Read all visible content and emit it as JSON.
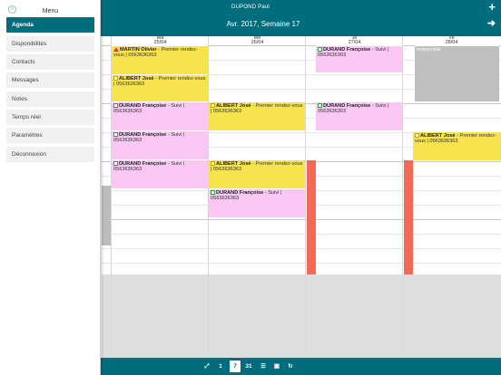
{
  "topbar": {
    "user_name": "DUPOND Paul",
    "week_title": "Avr. 2017, Semaine 17",
    "add_label": "+",
    "next_label": "➜"
  },
  "days": [
    {
      "name": "Ma",
      "date": "25/04"
    },
    {
      "name": "Me",
      "date": "26/04"
    },
    {
      "name": "Je",
      "date": "27/04"
    },
    {
      "name": "Ve",
      "date": "28/04"
    }
  ],
  "events": [
    {
      "who": "MARTIN Olivier",
      "detail": " - Premier rendez-vous | 0563636363",
      "color": "yellow",
      "icon": "warn"
    },
    {
      "who": "ALIBERT José",
      "detail": " - Premier rendez-vous | 0563636363",
      "color": "yellow",
      "icon": "note"
    },
    {
      "who": "DURAND Françoise",
      "detail": " - Suivi | 0563636363",
      "color": "pink",
      "icon": "ok"
    },
    {
      "who": "DURAND Françoise",
      "detail": " - Suivi | 0563636363",
      "color": "pink",
      "icon": "ok"
    },
    {
      "who": "DURAND Françoise",
      "detail": " - Suivi | 0563636363",
      "color": "pink",
      "icon": "ok"
    },
    {
      "who": "ALIBERT José",
      "detail": " - Premier rendez-vous | 0563636363",
      "color": "yellow",
      "icon": "note"
    },
    {
      "who": "ALIBERT José",
      "detail": " - Premier rendez-vous | 0563636363",
      "color": "yellow",
      "icon": "note"
    },
    {
      "who": "DURAND Françoise",
      "detail": " - Suivi | 0563636363",
      "color": "pink",
      "icon": "ok"
    },
    {
      "who": "DURAND Françoise",
      "detail": " - Suivi | 0563636363",
      "color": "pink",
      "icon": "ok"
    },
    {
      "who": "DURAND Françoise",
      "detail": " - Suivi | 0563636363",
      "color": "pink",
      "icon": "ok"
    },
    {
      "who": "",
      "detail": "Indisponible",
      "color": "grey",
      "icon": ""
    },
    {
      "who": "ALIBERT José",
      "detail": " - Premier rendez-vous | 0563636363",
      "color": "yellow",
      "icon": "note"
    }
  ],
  "bottombar": {
    "buttons": [
      {
        "label": "⤢",
        "icon": "expand-icon"
      },
      {
        "label": "1",
        "icon": ""
      },
      {
        "label": "7",
        "icon": "",
        "active": true
      },
      {
        "label": "31",
        "icon": ""
      },
      {
        "label": "☰",
        "icon": "list-icon"
      },
      {
        "label": "▣",
        "icon": "print-icon"
      },
      {
        "label": "↻",
        "icon": "refresh-icon"
      }
    ]
  },
  "menu": {
    "title": "Menu",
    "close_label": "×",
    "items": [
      {
        "label": "Agenda",
        "active": true
      },
      {
        "label": "Disponibilités"
      },
      {
        "label": "Contacts"
      },
      {
        "label": "Messages"
      },
      {
        "label": "Notes"
      },
      {
        "label": "Temps réel"
      },
      {
        "label": "Paramètres"
      },
      {
        "label": "Déconnexion"
      }
    ]
  },
  "colors": {
    "primary": "#006d7d",
    "event_yellow": "#f7e34e",
    "event_pink": "#fbc7f5",
    "unavailable": "#bfbfbf",
    "red_block": "#f06a55"
  }
}
